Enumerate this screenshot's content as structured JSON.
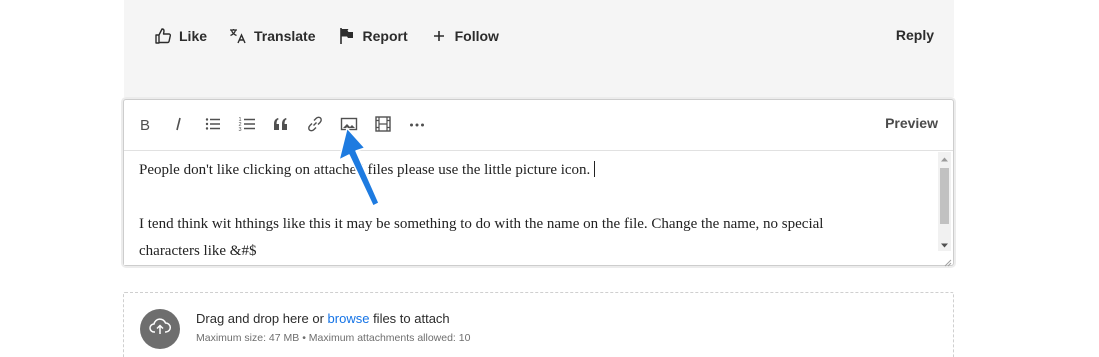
{
  "post_actions": {
    "like": "Like",
    "translate": "Translate",
    "report": "Report",
    "follow": "Follow",
    "reply": "Reply"
  },
  "editor": {
    "preview": "Preview",
    "toolbar_icons": [
      "bold-icon",
      "italic-icon",
      "bulleted-list-icon",
      "numbered-list-icon",
      "quote-icon",
      "link-icon",
      "image-icon",
      "video-icon",
      "more-icon"
    ],
    "paragraphs": [
      "People don't like clicking on attached files please use the little picture icon.",
      "I tend think wit hthings like this it may be something to do with the name on the file.  Change the name, no special",
      "characters like &#$"
    ]
  },
  "dropzone": {
    "text_before": "Drag and drop here or ",
    "browse": "browse",
    "text_after": " files to attach",
    "limits": "Maximum size: 47 MB • Maximum attachments allowed: 10"
  },
  "colors": {
    "link": "#1473e6",
    "annotation_arrow": "#1e7be0",
    "panel_bg": "#f5f5f5"
  }
}
